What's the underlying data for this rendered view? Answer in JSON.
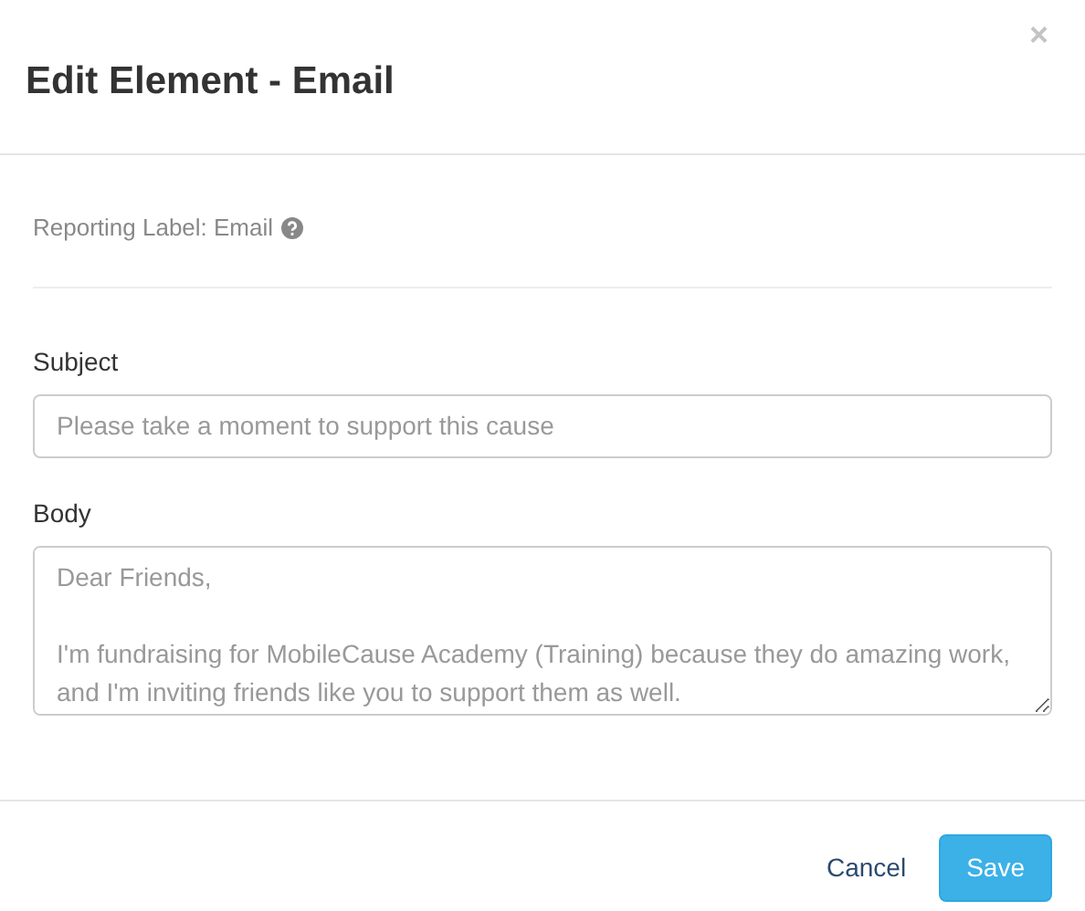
{
  "modal": {
    "title": "Edit Element - Email",
    "close": "×"
  },
  "reporting_label": "Reporting Label: Email",
  "fields": [
    {
      "kind": "input",
      "label": "Subject",
      "placeholder": "Please take a moment to support this cause"
    },
    {
      "kind": "textarea",
      "label": "Body",
      "placeholder": "Dear Friends,\n\nI'm fundraising for MobileCause Academy (Training) because they do amazing work, and I'm inviting friends like you to support them as well."
    }
  ],
  "buttons": [
    {
      "kind": "link",
      "label": "Cancel"
    },
    {
      "kind": "primary",
      "label": "Save"
    }
  ]
}
